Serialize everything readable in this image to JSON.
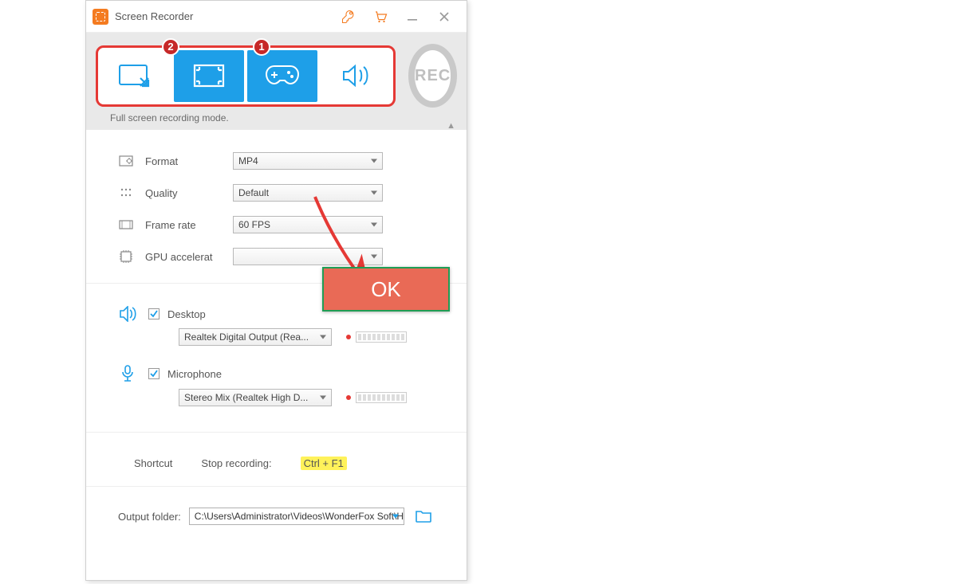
{
  "title": "Screen Recorder",
  "titlebar": {
    "rec_label": "REC"
  },
  "mode": {
    "caption": "Full screen recording mode.",
    "badge1": "1",
    "badge2": "2"
  },
  "settings": {
    "format_label": "Format",
    "format_value": "MP4",
    "quality_label": "Quality",
    "quality_value": "Default",
    "framerate_label": "Frame rate",
    "framerate_value": "60 FPS",
    "gpu_label": "GPU accelerat"
  },
  "audio": {
    "desktop_label": "Desktop",
    "desktop_device": "Realtek Digital Output (Rea...",
    "mic_label": "Microphone",
    "mic_device": "Stereo Mix (Realtek High D..."
  },
  "shortcut": {
    "label": "Shortcut",
    "stop_label": "Stop recording:",
    "stop_key": "Ctrl + F1"
  },
  "output": {
    "label": "Output folder:",
    "path": "C:\\Users\\Administrator\\Videos\\WonderFox Soft\\HD Vide"
  },
  "annotation": {
    "ok": "OK"
  }
}
